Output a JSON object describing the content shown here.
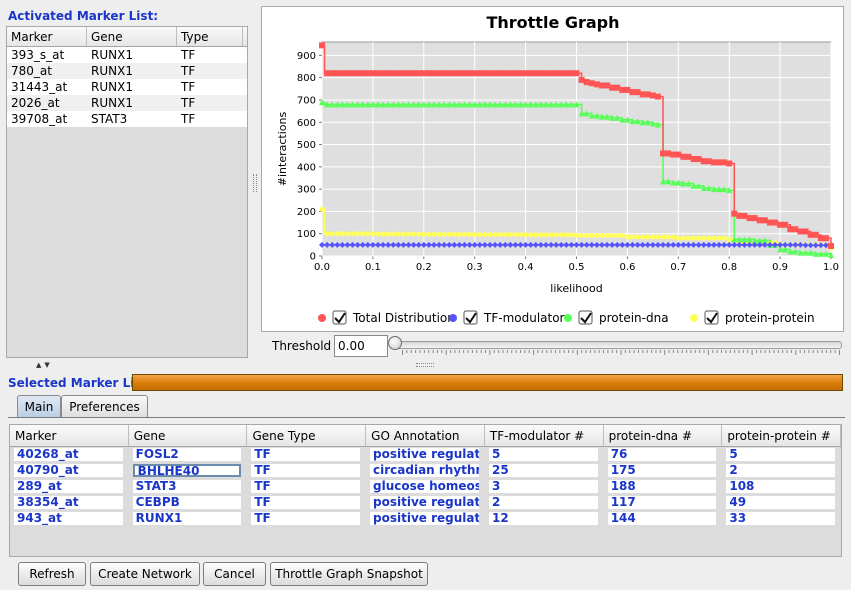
{
  "activated": {
    "label": "Activated Marker List:",
    "columns": [
      "Marker",
      "Gene",
      "Type"
    ],
    "rows": [
      [
        "393_s_at",
        "RUNX1",
        "TF"
      ],
      [
        "780_at",
        "RUNX1",
        "TF"
      ],
      [
        "31443_at",
        "RUNX1",
        "TF"
      ],
      [
        "2026_at",
        "RUNX1",
        "TF"
      ],
      [
        "39708_at",
        "STAT3",
        "TF"
      ]
    ]
  },
  "chart_data": {
    "type": "line",
    "title": "Throttle Graph",
    "xlabel": "likelihood",
    "ylabel": "#interactions",
    "xlim": [
      0.0,
      1.0
    ],
    "ylim": [
      0,
      960
    ],
    "xticks": [
      "0.0",
      "0.1",
      "0.2",
      "0.3",
      "0.4",
      "0.5",
      "0.6",
      "0.7",
      "0.8",
      "0.9",
      "1.0"
    ],
    "yticks": [
      "0",
      "100",
      "200",
      "300",
      "400",
      "500",
      "600",
      "700",
      "800",
      "900"
    ],
    "grid": true,
    "legend_position": "bottom",
    "series": [
      {
        "name": "Total Distribution",
        "color": "#ff5555",
        "marker": "square",
        "x": [
          0.0,
          0.005,
          0.5,
          0.51,
          0.52,
          0.53,
          0.54,
          0.55,
          0.57,
          0.59,
          0.61,
          0.63,
          0.65,
          0.66,
          0.67,
          0.69,
          0.71,
          0.73,
          0.75,
          0.77,
          0.8,
          0.81,
          0.82,
          0.84,
          0.86,
          0.88,
          0.9,
          0.92,
          0.94,
          0.96,
          0.98,
          1.0
        ],
        "y": [
          945,
          820,
          820,
          790,
          780,
          775,
          770,
          765,
          755,
          745,
          735,
          725,
          720,
          715,
          460,
          455,
          445,
          435,
          425,
          420,
          415,
          190,
          180,
          170,
          160,
          150,
          140,
          120,
          110,
          95,
          80,
          45
        ]
      },
      {
        "name": "TF-modulator",
        "color": "#5555ff",
        "marker": "diamond",
        "x": [
          0.0,
          0.2,
          0.4,
          0.6,
          0.8,
          0.95,
          1.0
        ],
        "y": [
          50,
          50,
          50,
          50,
          50,
          48,
          45
        ]
      },
      {
        "name": "protein-dna",
        "color": "#55ff55",
        "marker": "triangle",
        "x": [
          0.0,
          0.005,
          0.5,
          0.51,
          0.53,
          0.55,
          0.57,
          0.59,
          0.61,
          0.63,
          0.65,
          0.66,
          0.67,
          0.69,
          0.71,
          0.73,
          0.75,
          0.77,
          0.8,
          0.81,
          0.85,
          0.88,
          0.9,
          0.92,
          0.94,
          0.97,
          1.0
        ],
        "y": [
          690,
          680,
          680,
          640,
          630,
          625,
          620,
          612,
          605,
          600,
          595,
          590,
          335,
          330,
          325,
          315,
          305,
          300,
          295,
          75,
          70,
          50,
          30,
          20,
          15,
          10,
          5
        ]
      },
      {
        "name": "protein-protein",
        "color": "#ffff55",
        "marker": "circle",
        "x": [
          0.0,
          0.005,
          0.1,
          0.2,
          0.3,
          0.4,
          0.5,
          0.6,
          0.7,
          0.8,
          0.82,
          0.9,
          1.0
        ],
        "y": [
          210,
          100,
          98,
          97,
          96,
          95,
          92,
          85,
          80,
          73,
          60,
          50,
          35
        ]
      }
    ]
  },
  "threshold": {
    "label": "Threshold",
    "value": "0.00",
    "position": 0.0
  },
  "selected": {
    "label": "Selected Marker List:",
    "tabs": [
      "Main",
      "Preferences"
    ],
    "columns": [
      "Marker",
      "Gene",
      "Gene Type",
      "GO Annotation",
      "TF-modulator #",
      "protein-dna #",
      "protein-protein #"
    ],
    "rows": [
      [
        "40268_at",
        "FOSL2",
        "TF",
        "positive regulation",
        "5",
        "76",
        "5"
      ],
      [
        "40790_at",
        "BHLHE40",
        "TF",
        "circadian rhythm;",
        "25",
        "175",
        "2"
      ],
      [
        "289_at",
        "STAT3",
        "TF",
        "glucose homeostas",
        "3",
        "188",
        "108"
      ],
      [
        "38354_at",
        "CEBPB",
        "TF",
        "positive regulation",
        "2",
        "117",
        "49"
      ],
      [
        "943_at",
        "RUNX1",
        "TF",
        "positive regulation",
        "12",
        "144",
        "33"
      ]
    ]
  },
  "buttons": {
    "refresh": "Refresh",
    "create": "Create Network",
    "cancel": "Cancel",
    "snapshot": "Throttle Graph Snapshot"
  },
  "icons": {
    "legend_checkbox": "checkbox-checked-icon",
    "splitter_arrows": "collapse-arrows-icon"
  }
}
